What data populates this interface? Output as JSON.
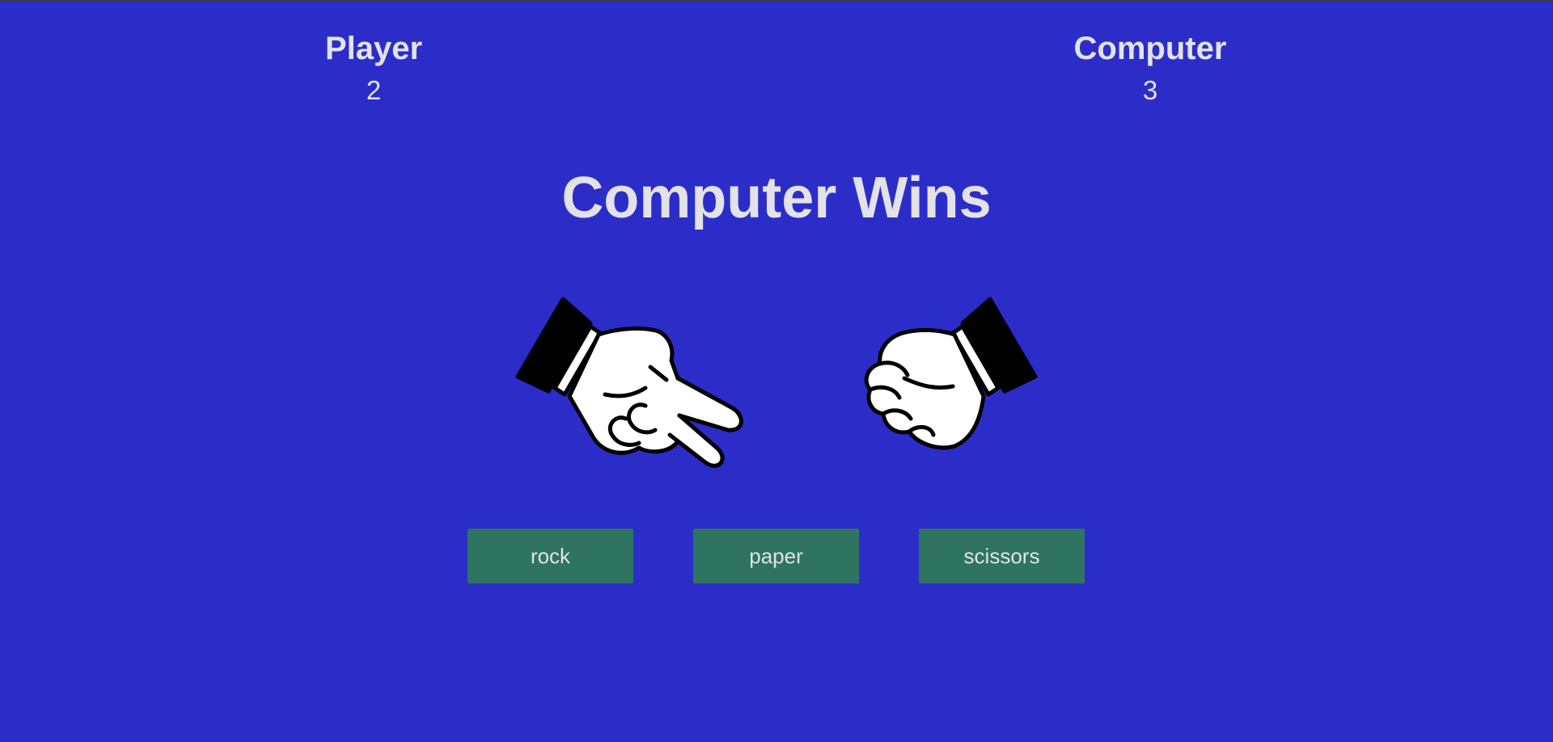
{
  "scoreboard": {
    "player": {
      "label": "Player",
      "score": "2"
    },
    "computer": {
      "label": "Computer",
      "score": "3"
    }
  },
  "result": {
    "text": "Computer Wins"
  },
  "hands": {
    "player": {
      "choice": "scissors",
      "icon": "scissors-hand-icon"
    },
    "computer": {
      "choice": "rock",
      "icon": "rock-fist-icon"
    }
  },
  "choices": [
    {
      "label": "rock"
    },
    {
      "label": "paper"
    },
    {
      "label": "scissors"
    }
  ],
  "colors": {
    "background": "#2c2dc8",
    "button": "#2e7461",
    "text": "#e2e2e8"
  }
}
